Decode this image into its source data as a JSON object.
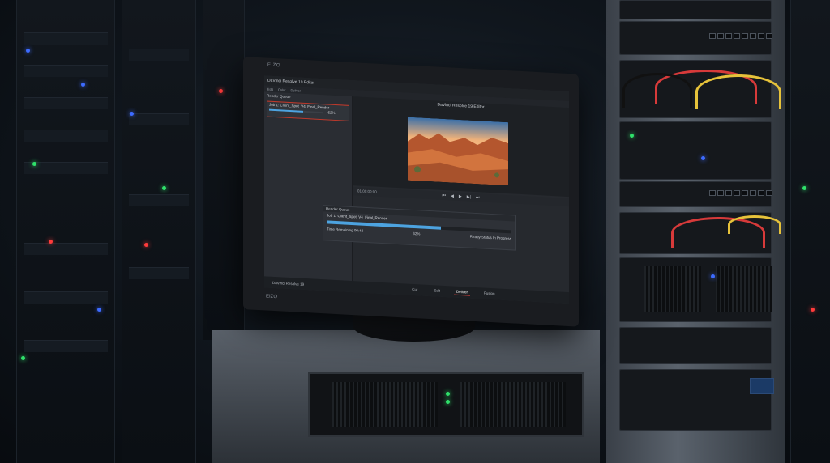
{
  "monitor": {
    "brand_top": "EIZO",
    "brand_bottom": "EIZO"
  },
  "app": {
    "window_title": "DaVinci Resolve 19 Editor",
    "menu_items": [
      "Edit",
      "Color",
      "Deliver"
    ],
    "logo_text": "DaVinci",
    "left_panel_title": "Render Queue",
    "job_name": "Job 1: Client_Spot_V4_Final_Render",
    "job_progress_percent": 62,
    "job_progress_label": "62%",
    "viewer_title": "DaVinci Resolve 19 Editor",
    "timecode": "01:00:00:00",
    "transport_icons": [
      "skip-back-icon",
      "step-back-icon",
      "play-icon",
      "step-forward-icon",
      "skip-forward-icon"
    ],
    "render_queue": {
      "title": "Render Queue",
      "job": "Job 1: Client_Spot_V4_Final_Render",
      "progress_percent": 62,
      "time_remaining_label": "Time Remaining",
      "time_remaining_value": "00:42",
      "percent_label": "62%",
      "status_label": "Ready Status",
      "status_value": "In Progress"
    },
    "bottom_bar": {
      "app_name": "DaVinci Resolve 19",
      "pages": [
        "Cut",
        "Edit",
        "Deliver",
        "Fusion"
      ],
      "active_page": "Deliver"
    }
  },
  "colors": {
    "accent_blue": "#4da3e0",
    "highlight_red": "#c0392b",
    "ui_dark": "#26292e"
  }
}
